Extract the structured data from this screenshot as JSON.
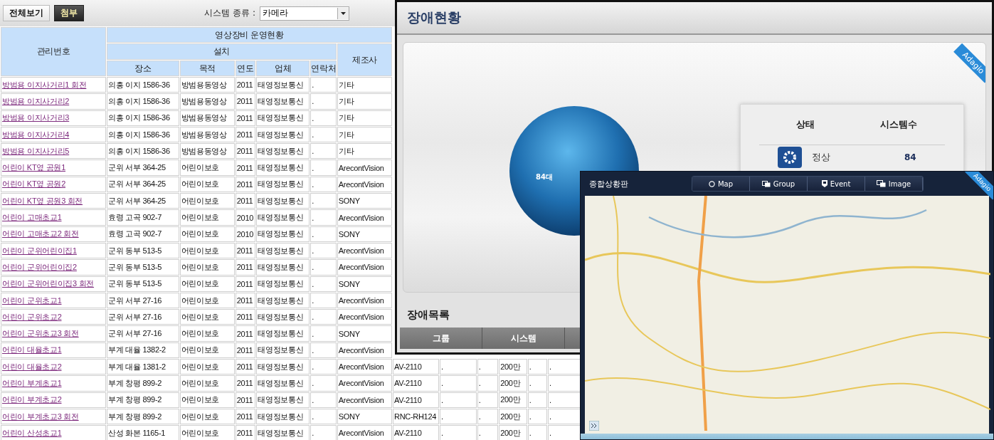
{
  "toolbar": {
    "tabs": [
      {
        "label": "전체보기",
        "selected": false
      },
      {
        "label": "첨부",
        "selected": true
      }
    ],
    "filter": {
      "label": "시스템 종류 :",
      "value": "카메라"
    }
  },
  "table": {
    "header": {
      "management_no": "관리번호",
      "group": "영상장비 운영현황",
      "install": "설치",
      "install_columns": [
        "장소",
        "목적",
        "연도",
        "업체",
        "연락처"
      ],
      "maker": "제조사"
    },
    "rows": [
      {
        "name": "방범용 이지사거리1 회전",
        "cells": [
          "의흥 이지 1586-36",
          "방범용동영상",
          "2011",
          "태영정보통신",
          ".",
          "기타"
        ]
      },
      {
        "name": "방범용 이지사거리2",
        "cells": [
          "의흥 이지 1586-36",
          "방범용동영상",
          "2011",
          "태영정보통신",
          ".",
          "기타"
        ]
      },
      {
        "name": "방범용 이지사거리3",
        "cells": [
          "의흥 이지 1586-36",
          "방범용동영상",
          "2011",
          "태영정보통신",
          ".",
          "기타"
        ]
      },
      {
        "name": "방범용 이지사거리4",
        "cells": [
          "의흥 이지 1586-36",
          "방범용동영상",
          "2011",
          "태영정보통신",
          ".",
          "기타"
        ]
      },
      {
        "name": "방범용 이지사거리5",
        "cells": [
          "의흥 이지 1586-36",
          "방범용동영상",
          "2011",
          "태영정보통신",
          ".",
          "기타"
        ]
      },
      {
        "name": "어린이 KT옆 공원1",
        "cells": [
          "군위 서부 364-25",
          "어린이보호",
          "2011",
          "태영정보통신",
          ".",
          "ArecontVision"
        ]
      },
      {
        "name": "어린이 KT옆 공원2",
        "cells": [
          "군위 서부 364-25",
          "어린이보호",
          "2011",
          "태영정보통신",
          ".",
          "ArecontVision"
        ]
      },
      {
        "name": "어린이 KT옆 공원3 회전",
        "cells": [
          "군위 서부 364-25",
          "어린이보호",
          "2011",
          "태영정보통신",
          ".",
          "SONY"
        ]
      },
      {
        "name": "어린이 고매초교1",
        "cells": [
          "효령 고곡 902-7",
          "어린이보호",
          "2010",
          "태영정보통신",
          ".",
          "ArecontVision"
        ]
      },
      {
        "name": "어린이 고매초교2 회전",
        "cells": [
          "효령 고곡 902-7",
          "어린이보호",
          "2010",
          "태영정보통신",
          ".",
          "SONY"
        ]
      },
      {
        "name": "어린이 군위어린이집1",
        "cells": [
          "군위 동부 513-5",
          "어린이보호",
          "2011",
          "태영정보통신",
          ".",
          "ArecontVision"
        ]
      },
      {
        "name": "어린이 군위어린이집2",
        "cells": [
          "군위 동부 513-5",
          "어린이보호",
          "2011",
          "태영정보통신",
          ".",
          "ArecontVision"
        ]
      },
      {
        "name": "어린이 군위어린이집3 회전",
        "cells": [
          "군위 동부 513-5",
          "어린이보호",
          "2011",
          "태영정보통신",
          ".",
          "SONY"
        ]
      },
      {
        "name": "어린이 군위초교1",
        "cells": [
          "군위 서부 27-16",
          "어린이보호",
          "2011",
          "태영정보통신",
          ".",
          "ArecontVision"
        ]
      },
      {
        "name": "어린이 군위초교2",
        "cells": [
          "군위 서부 27-16",
          "어린이보호",
          "2011",
          "태영정보통신",
          ".",
          "ArecontVision"
        ]
      },
      {
        "name": "어린이 군위초교3 회전",
        "cells": [
          "군위 서부 27-16",
          "어린이보호",
          "2011",
          "태영정보통신",
          ".",
          "SONY"
        ]
      },
      {
        "name": "어린이 대율초교1",
        "cells": [
          "부계 대율 1382-2",
          "어린이보호",
          "2011",
          "태영정보통신",
          ".",
          "ArecontVision"
        ]
      },
      {
        "name": "어린이 대율초교2",
        "cells": [
          "부계 대율 1381-2",
          "어린이보호",
          "2011",
          "태영정보통신",
          ".",
          "ArecontVision"
        ],
        "extra": [
          "AV-2110",
          ".",
          ".",
          "200만",
          ".",
          "."
        ]
      },
      {
        "name": "어린이 부계초교1",
        "cells": [
          "부계 창평 899-2",
          "어린이보호",
          "2011",
          "태영정보통신",
          ".",
          "ArecontVision"
        ],
        "extra": [
          "AV-2110",
          ".",
          ".",
          "200만",
          ".",
          "."
        ]
      },
      {
        "name": "어린이 부계초교2",
        "cells": [
          "부계 창평 899-2",
          "어린이보호",
          "2011",
          "태영정보통신",
          ".",
          "ArecontVision"
        ],
        "extra": [
          "AV-2110",
          ".",
          ".",
          "200만",
          ".",
          "."
        ]
      },
      {
        "name": "어린이 부계초교3 회전",
        "cells": [
          "부계 창평 899-2",
          "어린이보호",
          "2011",
          "태영정보통신",
          ".",
          "SONY"
        ],
        "extra": [
          "RNC-RH124",
          ".",
          ".",
          "200만",
          ".",
          "."
        ]
      },
      {
        "name": "어린이 산성초교1",
        "cells": [
          "산성 화본 1165-1",
          "어린이보호",
          "2011",
          "태영정보통신",
          ".",
          "ArecontVision"
        ],
        "extra": [
          "AV-2110",
          ".",
          ".",
          "200만",
          ".",
          "."
        ]
      }
    ]
  },
  "status_window": {
    "title": "장애현황",
    "ribbon": "Adagio",
    "chart_label": "84대",
    "card": {
      "headers": [
        "상태",
        "시스템수"
      ],
      "rows": [
        {
          "label": "정상",
          "count": "84"
        }
      ]
    },
    "list_title": "장애목록",
    "list_columns": [
      "그룹",
      "시스템"
    ]
  },
  "map_window": {
    "title": "종합상황판",
    "ribbon": "Adagio",
    "buttons": [
      {
        "label": "Map",
        "kind": "map"
      },
      {
        "label": "Group",
        "kind": "group"
      },
      {
        "label": "Event",
        "kind": "event"
      },
      {
        "label": "Image",
        "kind": "image"
      }
    ]
  }
}
